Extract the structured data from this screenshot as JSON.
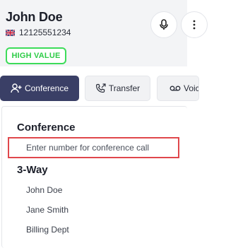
{
  "contact": {
    "name": "John Doe",
    "phone": "12125551234",
    "flag_icon": "uk-flag-icon",
    "badge": "HIGH VALUE",
    "badge_color": "#3ddc5a"
  },
  "header_buttons": [
    {
      "icon": "microphone-icon"
    },
    {
      "icon": "more-icon"
    }
  ],
  "tabs": [
    {
      "label": "Conference",
      "icon": "add-user-icon",
      "active": true
    },
    {
      "label": "Transfer",
      "icon": "phone-forward-icon",
      "active": false
    },
    {
      "label": "Voicemail",
      "icon": "voicemail-icon",
      "active": false
    }
  ],
  "dropdown": {
    "conference_title": "Conference",
    "conference_placeholder": "Enter number for conference call",
    "three_way_title": "3-Way",
    "contacts": [
      "John Doe",
      "Jane Smith",
      "Billing Dept"
    ]
  },
  "colors": {
    "active_tab": "#3a3f66",
    "input_border": "#e0474c"
  }
}
